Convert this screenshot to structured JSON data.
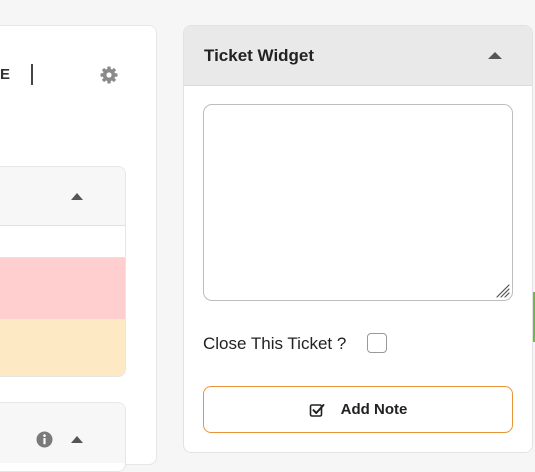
{
  "left_panel": {
    "header_text": "E"
  },
  "widget": {
    "title": "Ticket Widget",
    "note_value": "",
    "close_label": "Close This Ticket ?",
    "close_checked": false,
    "add_note_label": "Add Note"
  },
  "icons": {
    "gear": "gear-icon",
    "caret": "caret-up-icon",
    "paperclip": "paperclip-icon",
    "info": "info-circle-icon",
    "add_note": "check-square-icon"
  },
  "colors": {
    "button_border": "#e8953a",
    "row_red": "#ffcfcf",
    "row_yellow": "#fde9c4",
    "header_bg": "#e9e9e9",
    "accent_green": "#6cb84a"
  }
}
